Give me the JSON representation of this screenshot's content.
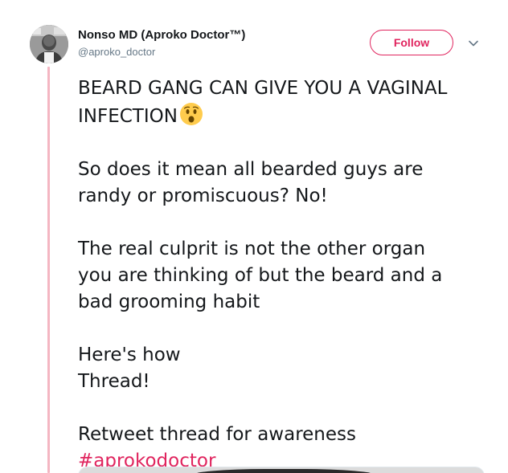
{
  "author": {
    "name": "Nonso MD (Aproko Doctor™)",
    "handle": "@aproko_doctor"
  },
  "actions": {
    "follow_label": "Follow",
    "menu_icon": "chevron-down-icon"
  },
  "tweet": {
    "line1": "BEARD GANG CAN GIVE YOU A VAGINAL",
    "line2": "INFECTION",
    "emoji": "hushed-face-emoji",
    "p2_line1": "So does it mean all bearded guys are",
    "p2_line2": "randy or promiscuous? No!",
    "p3_line1": "The real culprit is not the other organ",
    "p3_line2": "you are thinking of but the beard and a",
    "p3_line3": "bad grooming habit",
    "p4_line1": "Here's how",
    "p4_line2": "Thread!",
    "p5_line1": "Retweet thread for awareness",
    "hashtag": "#aprokodoctor"
  },
  "colors": {
    "accent": "#e0245e",
    "thread_line": "#f4b6c2",
    "secondary_text": "#657786",
    "primary_text": "#14171a"
  }
}
